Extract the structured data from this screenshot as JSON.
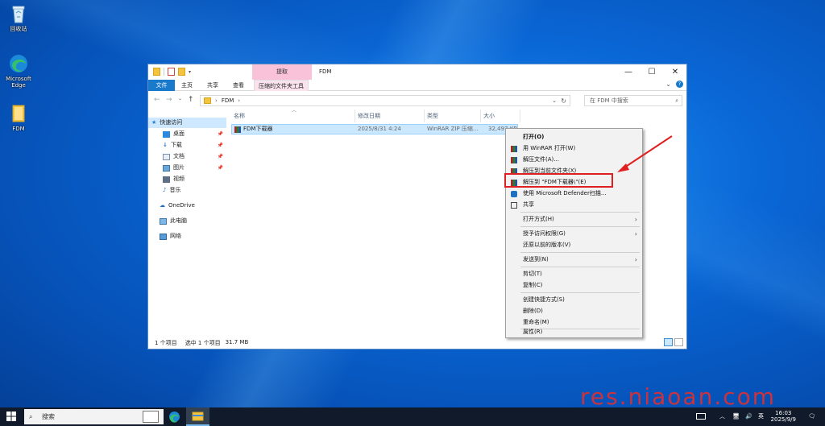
{
  "desktop": {
    "icons": [
      {
        "label": "回收站"
      },
      {
        "label": "Microsoft Edge"
      },
      {
        "label": "FDM"
      }
    ],
    "watermark": "res.niaoan.com"
  },
  "window": {
    "title": "FDM",
    "context_tab": "提取",
    "ribbon_tabs": [
      "文件",
      "主页",
      "共享",
      "查看",
      "压缩的文件夹工具"
    ],
    "address_path": [
      "FDM"
    ],
    "search_placeholder": "在 FDM 中搜索",
    "nav": {
      "quick_access": "快速访问",
      "items": [
        {
          "label": "桌面",
          "pinned": true
        },
        {
          "label": "下载",
          "pinned": true
        },
        {
          "label": "文档",
          "pinned": true
        },
        {
          "label": "图片",
          "pinned": true
        },
        {
          "label": "视频",
          "pinned": false
        },
        {
          "label": "音乐",
          "pinned": false
        }
      ],
      "onedrive": "OneDrive",
      "this_pc": "此电脑",
      "network": "网络"
    },
    "columns": {
      "name": "名称",
      "date": "修改日期",
      "type": "类型",
      "size": "大小"
    },
    "file": {
      "name": "FDM下载器",
      "date": "2025/8/31 4:24",
      "type": "WinRAR ZIP 压缩...",
      "size": "32,497 KB"
    },
    "status": {
      "count": "1 个项目",
      "selected": "选中 1 个项目",
      "size": "31.7 MB"
    }
  },
  "context_menu": {
    "items": [
      {
        "label": "打开(O)",
        "bold": true,
        "icon": "none"
      },
      {
        "label": "用 WinRAR 打开(W)",
        "icon": "winrar-icon"
      },
      {
        "label": "解压文件(A)...",
        "icon": "winrar-icon"
      },
      {
        "label": "解压到当前文件夹(X)",
        "icon": "winrar-icon"
      },
      {
        "label": "解压到 \"FDM下载器\\\"(E)",
        "icon": "winrar-icon",
        "highlighted": true
      },
      {
        "label": "使用 Microsoft Defender扫描...",
        "icon": "defender-icon"
      },
      {
        "label": "共享",
        "icon": "share-icon"
      },
      {
        "label": "打开方式(H)",
        "submenu": true
      },
      {
        "label": "授予访问权限(G)",
        "submenu": true
      },
      {
        "label": "还原以前的版本(V)"
      },
      {
        "label": "发送到(N)",
        "submenu": true
      },
      {
        "label": "剪切(T)"
      },
      {
        "label": "复制(C)"
      },
      {
        "label": "创建快捷方式(S)"
      },
      {
        "label": "删除(D)"
      },
      {
        "label": "重命名(M)"
      },
      {
        "label": "属性(R)"
      }
    ]
  },
  "taskbar": {
    "search_label": "搜索",
    "ime": "英",
    "time": "16:03",
    "date": "2025/9/9"
  }
}
